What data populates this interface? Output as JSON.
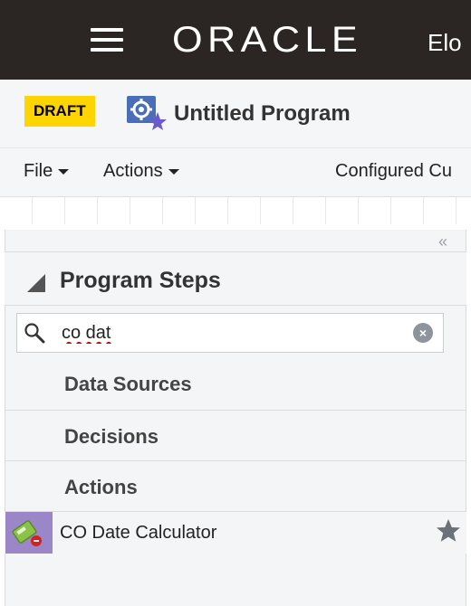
{
  "header": {
    "logo": "ORACLE",
    "product": "Elo"
  },
  "program": {
    "status_badge": "DRAFT",
    "title": "Untitled Program"
  },
  "menubar": {
    "file": "File",
    "actions": "Actions",
    "configured": "Configured Cu"
  },
  "panel": {
    "collapse_glyph": "«",
    "title": "Program Steps",
    "search": {
      "value": "co dat"
    },
    "categories": [
      "Data Sources",
      "Decisions",
      "Actions"
    ],
    "results": [
      {
        "label": "CO Date Calculator",
        "icon": "calculator-step-icon",
        "favorite_icon": "star-icon"
      }
    ]
  },
  "colors": {
    "topbar": "#2b2623",
    "draft_badge": "#ffd500",
    "panel_bg": "#f4f5f6",
    "step_icon_bg": "#9b86c8"
  }
}
